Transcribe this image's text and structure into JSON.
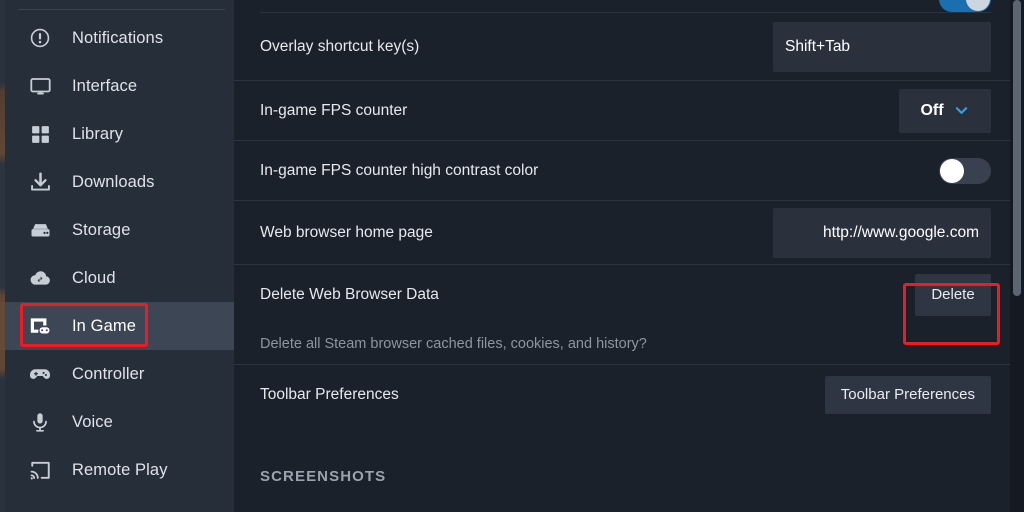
{
  "app": {
    "section_name": "In Game"
  },
  "sidebar": {
    "items": [
      {
        "label": "Notifications",
        "icon": "notifications-icon",
        "active": false
      },
      {
        "label": "Interface",
        "icon": "monitor-icon",
        "active": false
      },
      {
        "label": "Library",
        "icon": "grid-icon",
        "active": false
      },
      {
        "label": "Downloads",
        "icon": "download-icon",
        "active": false
      },
      {
        "label": "Storage",
        "icon": "drive-icon",
        "active": false
      },
      {
        "label": "Cloud",
        "icon": "cloud-sync-icon",
        "active": false
      },
      {
        "label": "In Game",
        "icon": "in-game-icon",
        "active": true
      },
      {
        "label": "Controller",
        "icon": "gamepad-icon",
        "active": false
      },
      {
        "label": "Voice",
        "icon": "microphone-icon",
        "active": false
      },
      {
        "label": "Remote Play",
        "icon": "cast-icon",
        "active": false
      }
    ]
  },
  "main": {
    "rows": [
      {
        "label": "Overlay shortcut key(s)",
        "control": "text",
        "value": "Shift+Tab",
        "placeholder": ""
      },
      {
        "label": "In-game FPS counter",
        "control": "dropdown",
        "value": "Off"
      },
      {
        "label": "In-game FPS counter high contrast color",
        "control": "toggle",
        "value": "off"
      },
      {
        "label": "Web browser home page",
        "control": "text",
        "value": "http://www.google.com",
        "placeholder": ""
      },
      {
        "label": "Delete Web Browser Data",
        "control": "button",
        "button_label": "Delete",
        "description": "Delete all Steam browser cached files, cookies, and history?"
      },
      {
        "label": "Toolbar Preferences",
        "control": "button",
        "button_label": "Toolbar Preferences"
      }
    ],
    "section_header": "SCREENSHOTS"
  },
  "colors": {
    "accent": "#3a9ee0",
    "annotation": "#ee1b24",
    "sidebar_bg": "#262e3a",
    "content_bg": "#1b212b",
    "active_row": "#3c4654"
  }
}
